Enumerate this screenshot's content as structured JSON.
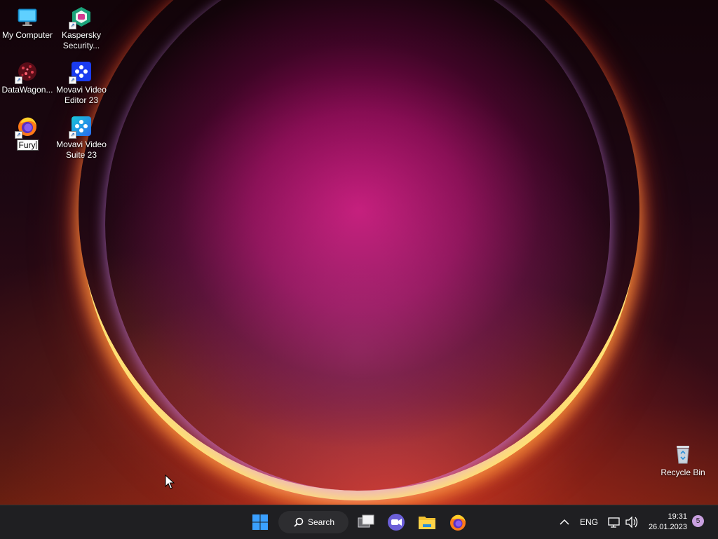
{
  "desktop": {
    "icons": [
      {
        "label": "My Computer",
        "icon": "monitor-icon"
      },
      {
        "label": "Kaspersky Security...",
        "icon": "kaspersky-icon"
      },
      {
        "label": "DataWagon...",
        "icon": "datawagon-icon"
      },
      {
        "label": "Movavi Video Editor 23",
        "icon": "movavi-editor-icon"
      },
      {
        "label": "Fury",
        "icon": "firefox-icon",
        "renaming": true
      },
      {
        "label": "Movavi Video Suite 23",
        "icon": "movavi-suite-icon"
      },
      {
        "label": "Recycle Bin",
        "icon": "recycle-bin-icon"
      }
    ]
  },
  "taskbar": {
    "search_label": "Search",
    "apps": [
      "start-icon",
      "task-view-icon",
      "teams-chat-icon",
      "file-explorer-icon",
      "firefox-icon"
    ]
  },
  "tray": {
    "language": "ENG",
    "time": "19:31",
    "date": "26.01.2023",
    "notification_count": "5"
  },
  "colors": {
    "taskbar_bg": "#1f1f22",
    "start_blue": "#0a84ff",
    "movavi_blue": "#1a3cf0",
    "kaspersky_green": "#1aa37a"
  }
}
